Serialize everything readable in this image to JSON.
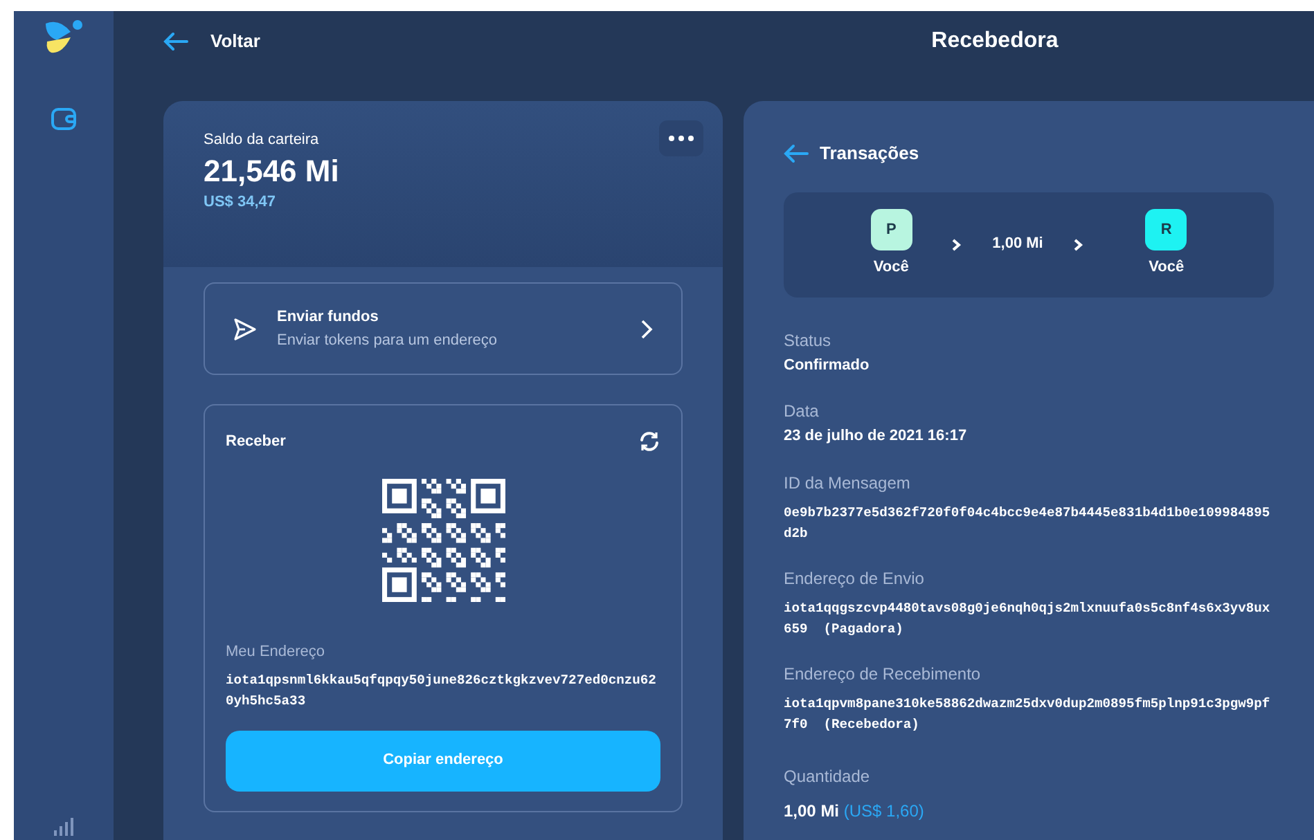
{
  "sidebar": {
    "items": [
      {
        "kind": "wallet",
        "selected": true
      },
      {
        "kind": "chart",
        "selected": false
      }
    ]
  },
  "header": {
    "back_label": "Voltar",
    "title": "Recebedora"
  },
  "balance": {
    "label": "Saldo da carteira",
    "amount": "21,546 Mi",
    "fiat": "US$ 34,47"
  },
  "send": {
    "title": "Enviar fundos",
    "subtitle": "Enviar tokens para um endereço"
  },
  "receive": {
    "title": "Receber",
    "address_label": "Meu Endereço",
    "address": "iota1qpsnml6kkau5qfqpqy50june826cztkgkzvev727ed0cnzu620yh5hc5a33",
    "button": "Copiar endereço"
  },
  "transaction": {
    "back_label": "Transações",
    "flow": {
      "from": {
        "initial": "P",
        "name": "Você",
        "color": "#b8f5e0"
      },
      "amount": "1,00 Mi",
      "to": {
        "initial": "R",
        "name": "Você",
        "color": "#1ef2f2"
      }
    },
    "fields": [
      {
        "label": "Status",
        "value": "Confirmado",
        "kind": "text"
      },
      {
        "label": "Data",
        "value": "23 de julho de 2021 16:17",
        "kind": "text"
      },
      {
        "label": "ID da Mensagem",
        "value": "0e9b7b2377e5d362f720f0f04c4bcc9e4e87b4445e831b4d1b0e109984895d2b",
        "kind": "mono"
      },
      {
        "label": "Endereço de Envio",
        "value": "iota1qqgszcvp4480tavs08g0je6nqh0qjs2mlxnuufa0s5c8nf4s6x3yv8ux659  (Pagadora)",
        "kind": "mono"
      },
      {
        "label": "Endereço de Recebimento",
        "value": "iota1qpvm8pane310ke58862dwazm25dxv0dup2m0895fm5plnp91c3pgw9pf7f0  (Recebedora)",
        "kind": "mono"
      }
    ],
    "quantity": {
      "label": "Quantidade",
      "amount": "1,00 Mi",
      "fiat": "(US$ 1,60)"
    }
  }
}
